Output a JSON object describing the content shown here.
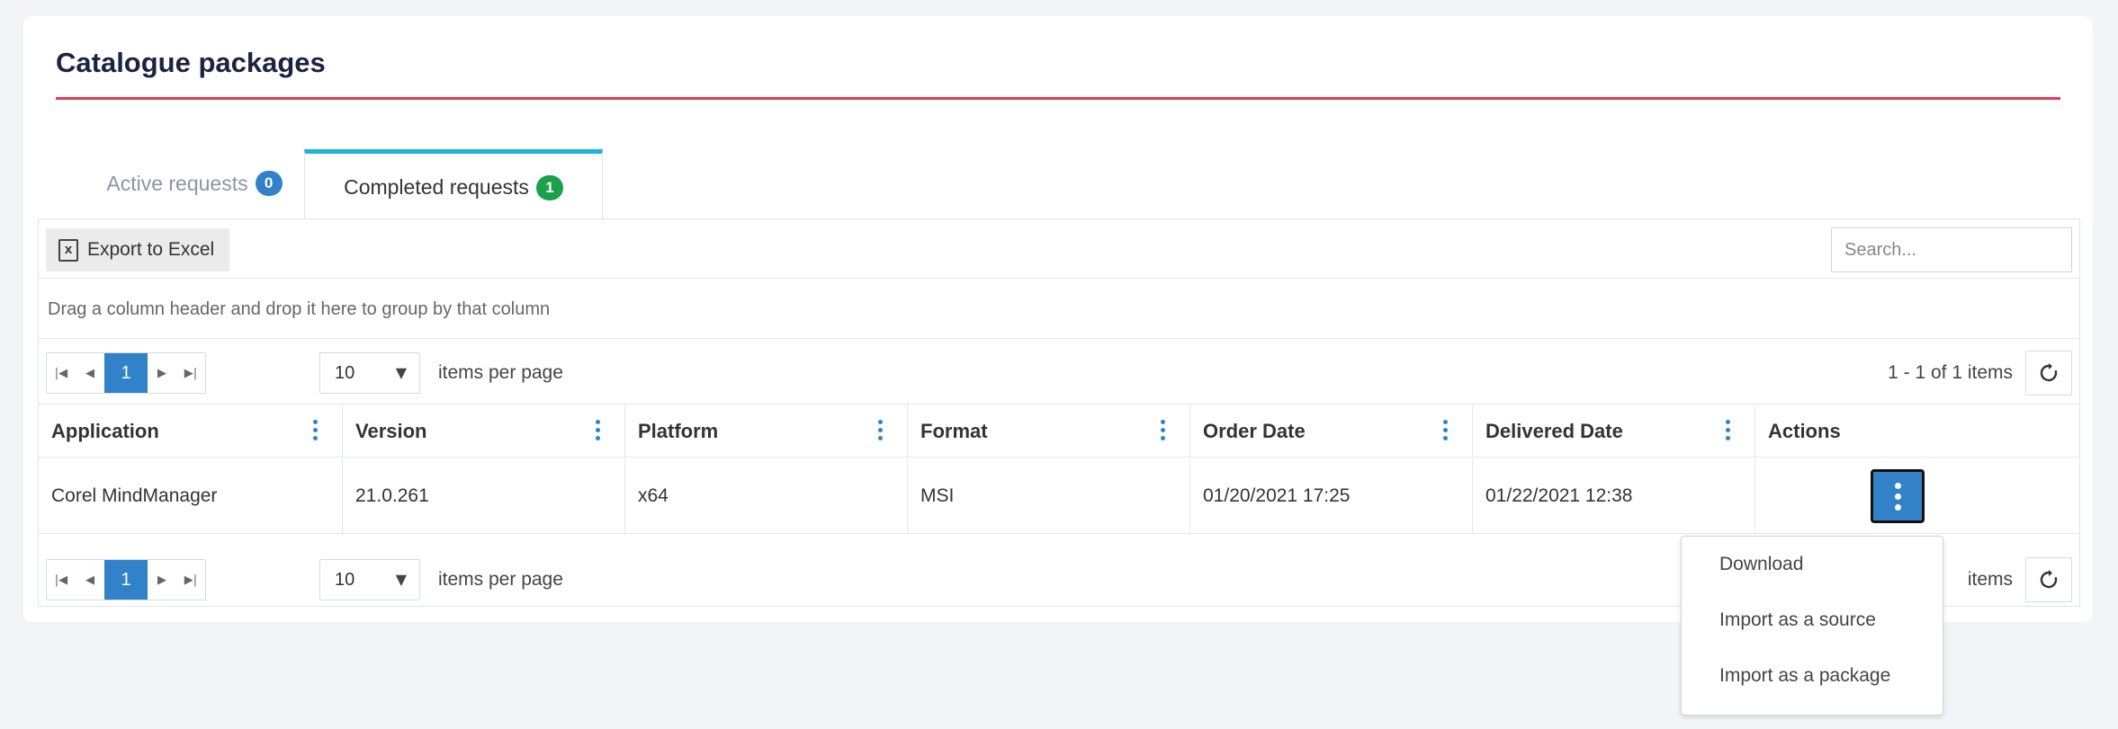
{
  "page": {
    "title": "Catalogue packages"
  },
  "colors": {
    "accent_rule": "#e23a55",
    "tab_accent": "#1db1dd",
    "primary": "#3182c8",
    "badge_active": "#3182c8",
    "badge_completed": "#1aa14a"
  },
  "tabs": [
    {
      "label": "Active requests",
      "count": "0"
    },
    {
      "label": "Completed requests",
      "count": "1"
    }
  ],
  "toolbar": {
    "export_label": "Export to Excel",
    "search_placeholder": "Search..."
  },
  "group_hint": "Drag a column header and drop it here to group by that column",
  "pager": {
    "current_page": "1",
    "page_size": "10",
    "items_per_page_label": "items per page",
    "info": "1 - 1 of 1 items",
    "info_partial": "items"
  },
  "columns": [
    "Application",
    "Version",
    "Platform",
    "Format",
    "Order Date",
    "Delivered Date",
    "Actions"
  ],
  "rows": [
    [
      "Corel MindManager",
      "21.0.261",
      "x64",
      "MSI",
      "01/20/2021 17:25",
      "01/22/2021 12:38"
    ]
  ],
  "actions_menu": [
    "Download",
    "Import as a source",
    "Import as a package"
  ],
  "icons": {
    "export": "excel-icon",
    "first": "first-page-icon",
    "prev": "prev-page-icon",
    "next": "next-page-icon",
    "last": "last-page-icon",
    "refresh": "refresh-icon",
    "column_menu": "kebab-icon",
    "row_actions": "kebab-icon"
  }
}
